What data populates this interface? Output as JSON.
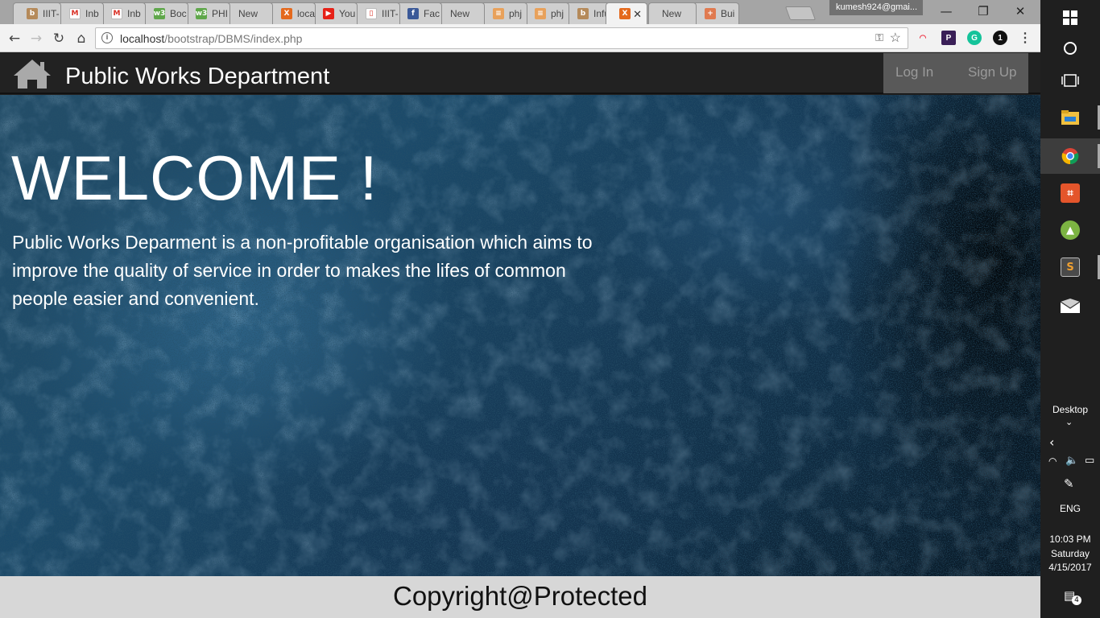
{
  "browser": {
    "tabs": [
      {
        "title": "IIIT-",
        "favicon": "book-icon",
        "color": "#b58a5a",
        "glyph": "b"
      },
      {
        "title": "Inb",
        "favicon": "gmail-icon",
        "color": "#ffffff",
        "glyph": "M"
      },
      {
        "title": "Inb",
        "favicon": "gmail-icon",
        "color": "#ffffff",
        "glyph": "M"
      },
      {
        "title": "Boc",
        "favicon": "w3schools-icon",
        "color": "#5fa74a",
        "glyph": "w3"
      },
      {
        "title": "PHI",
        "favicon": "w3schools-icon",
        "color": "#5fa74a",
        "glyph": "w3"
      },
      {
        "title": "New Ta",
        "favicon": "",
        "color": "",
        "glyph": ""
      },
      {
        "title": "loca",
        "favicon": "xampp-icon",
        "color": "#e4691d",
        "glyph": "X"
      },
      {
        "title": "You",
        "favicon": "youtube-icon",
        "color": "#e62117",
        "glyph": "▶"
      },
      {
        "title": "IIIT-",
        "favicon": "document-icon",
        "color": "#ffffff",
        "glyph": "▯"
      },
      {
        "title": "Fac",
        "favicon": "facebook-icon",
        "color": "#3b5998",
        "glyph": "f"
      },
      {
        "title": "New Ta",
        "favicon": "",
        "color": "",
        "glyph": ""
      },
      {
        "title": "phj",
        "favicon": "stackoverflow-icon",
        "color": "#e8a15b",
        "glyph": "≡"
      },
      {
        "title": "phj",
        "favicon": "stackoverflow-icon",
        "color": "#e8a15b",
        "glyph": "≡"
      },
      {
        "title": "Infu",
        "favicon": "book-icon",
        "color": "#b58a5a",
        "glyph": "b"
      },
      {
        "title": "",
        "favicon": "xampp-icon",
        "color": "#e4691d",
        "glyph": "X",
        "active": true
      },
      {
        "title": "New Ta",
        "favicon": "",
        "color": "",
        "glyph": ""
      },
      {
        "title": "Bui",
        "favicon": "plus-icon",
        "color": "#e07a50",
        "glyph": "+"
      }
    ],
    "profile": "kumesh924@gmai...",
    "address": {
      "host": "localhost",
      "path": "/bootstrap/DBMS/index.php"
    }
  },
  "site": {
    "title": "Public Works Department",
    "login_label": "Log In",
    "signup_label": "Sign Up",
    "hero_heading": "WELCOME !",
    "hero_text": "Public Works Deparment is a non-profitable organisation which aims to improve the quality of service in order to makes the lifes of common people easier and convenient.",
    "footer": "Copyright@Protected"
  },
  "taskbar": {
    "desktop_label": "Desktop",
    "language": "ENG",
    "time": "10:03 PM",
    "day": "Saturday",
    "date": "4/15/2017",
    "notification_count": "4"
  }
}
